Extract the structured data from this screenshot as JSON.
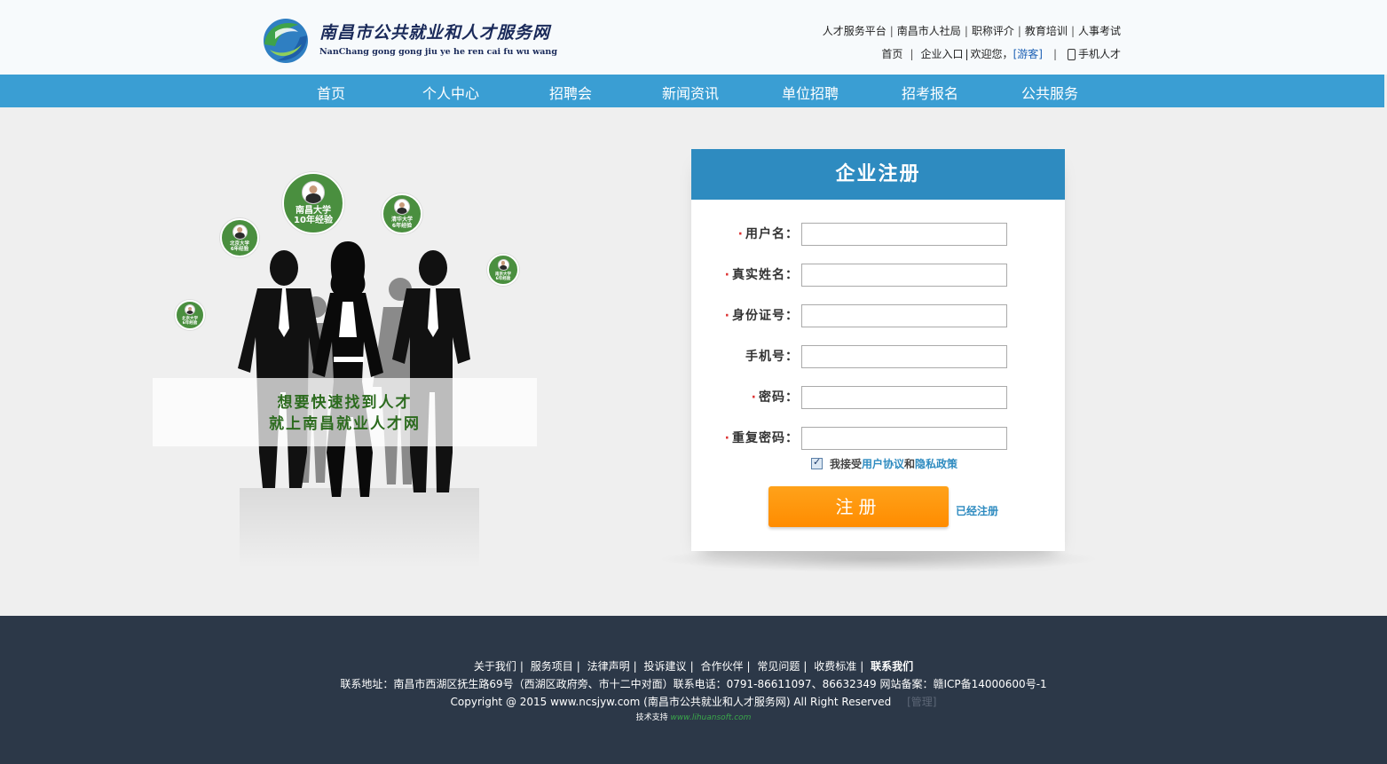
{
  "header": {
    "logo_cn": "南昌市公共就业和人才服务网",
    "logo_en": "NanChang gong gong jiu ye he ren cai fu wu wang",
    "top_links": [
      "人才服务平台",
      "南昌市人社局",
      "职称评介",
      "教育培训",
      "人事考试"
    ],
    "home": "首页",
    "enterprise_entry": "企业入口",
    "welcome": "欢迎您，",
    "guest": "[游客]",
    "mobile": "手机人才"
  },
  "nav": [
    "首页",
    "个人中心",
    "招聘会",
    "新闻资讯",
    "单位招聘",
    "招考报名",
    "公共服务"
  ],
  "promo": {
    "bubbles": [
      {
        "line1": "南昌大学",
        "line2": "10年经验"
      },
      {
        "line1": "清华大学",
        "line2": "6年经验"
      },
      {
        "line1": "北京大学",
        "line2": "6年经验"
      },
      {
        "line1": "南京大学",
        "line2": "6年经验"
      },
      {
        "line1": "北京大学",
        "line2": "6年经验"
      }
    ],
    "line1": "想要快速找到人才",
    "line2": "就上南昌就业人才网"
  },
  "form": {
    "title": "企业注册",
    "fields": [
      {
        "label": "用户名：",
        "required": "·",
        "value": ""
      },
      {
        "label": "真实姓名：",
        "required": "·",
        "value": ""
      },
      {
        "label": "身份证号：",
        "required": "·",
        "value": ""
      },
      {
        "label": "手机号：",
        "required": "",
        "value": ""
      },
      {
        "label": "密码：",
        "required": "·",
        "value": ""
      },
      {
        "label": "重复密码：",
        "required": "·",
        "value": ""
      }
    ],
    "agree_prefix": "我接受",
    "agree_link1": "用户协议",
    "agree_and": "和",
    "agree_link2": "隐私政策",
    "agree_checked": true,
    "submit": "注册",
    "already": "已经注册"
  },
  "footer": {
    "links": [
      "关于我们",
      "服务项目",
      "法律声明",
      "投诉建议",
      "合作伙伴",
      "常见问题",
      "收费标准",
      "联系我们"
    ],
    "address": "联系地址：南昌市西湖区抚生路69号（西湖区政府旁、市十二中对面）联系电话：0791-86611097、86632349 网站备案：赣ICP备14000600号-1",
    "copyright": "Copyright @ 2015 www.ncsjyw.com (南昌市公共就业和人才服务网) All Right Reserved",
    "admin": "[管理]",
    "tech_label": "技术支持",
    "tech_site": "www.lihuansoft.com"
  },
  "colors": {
    "nav_bg": "#3a9ed3",
    "panel_head": "#2e8bc0",
    "submit": "#ff8c00",
    "footer_bg": "#2c3848",
    "promo_green": "#4a8f3f"
  }
}
